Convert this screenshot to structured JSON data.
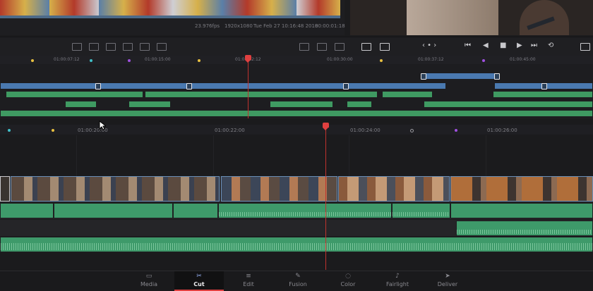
{
  "source_info": {
    "fps": "23.976fps",
    "resolution": "1920x1080",
    "date": "Tue Feb 27 10:16:48 2018",
    "timecode": "00:00:01:18"
  },
  "ruler_upper": {
    "t1": "01:00:07:12",
    "t2": "01:00:15:00",
    "t3": "01:00:22:12",
    "t4": "01:00:30:00",
    "t5": "01:00:37:12",
    "t6": "01:00:45:00"
  },
  "ruler_lower": {
    "t1": "01:00:20:00",
    "t2": "01:00:22:00",
    "t3": "01:00:24:00",
    "t4": "01:00:26:00"
  },
  "transport": {
    "nav": "‹ • ›",
    "first": "⏮",
    "prev": "◀",
    "stop": "■",
    "play": "▶",
    "last": "⏭",
    "loop": "⟲"
  },
  "pages": [
    {
      "label": "Media",
      "icon": "▭"
    },
    {
      "label": "Cut",
      "icon": "✂"
    },
    {
      "label": "Edit",
      "icon": "≡"
    },
    {
      "label": "Fusion",
      "icon": "✎"
    },
    {
      "label": "Color",
      "icon": "◌"
    },
    {
      "label": "Fairlight",
      "icon": "♪"
    },
    {
      "label": "Deliver",
      "icon": "➤"
    }
  ],
  "active_page": "Cut",
  "colors": {
    "video_clip": "#4a79b0",
    "audio_clip": "#3e9a6a",
    "playhead": "#e04040"
  }
}
